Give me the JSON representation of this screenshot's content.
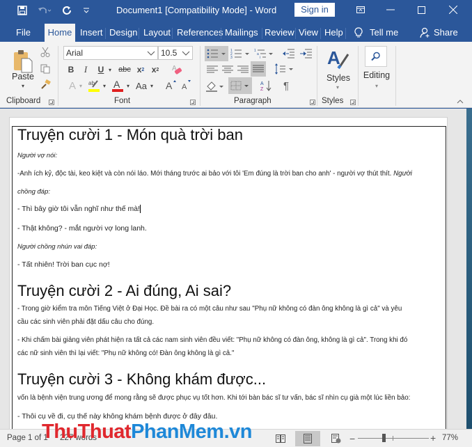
{
  "titlebar": {
    "title": "Document1 [Compatibility Mode]  -  Word",
    "sign_in": "Sign in",
    "qat": {
      "save_icon": "save-icon",
      "undo_icon": "undo-icon",
      "redo_icon": "redo-icon",
      "customize_icon": "customize-qat-icon"
    }
  },
  "tabs": [
    {
      "label": "File"
    },
    {
      "label": "Home",
      "active": true
    },
    {
      "label": "Insert"
    },
    {
      "label": "Design"
    },
    {
      "label": "Layout"
    },
    {
      "label": "References"
    },
    {
      "label": "Mailings"
    },
    {
      "label": "Review"
    },
    {
      "label": "View"
    },
    {
      "label": "Help"
    }
  ],
  "tell_me": "Tell me",
  "share": "Share",
  "ribbon": {
    "clipboard": {
      "label": "Clipboard",
      "paste": "Paste"
    },
    "font": {
      "label": "Font",
      "font_name": "Arial",
      "font_size": "10.5",
      "bold": "B",
      "italic": "I",
      "underline": "U",
      "strike": "abc",
      "subscript": "x",
      "superscript": "x",
      "change_case": "Aa",
      "highlight_color": "#ffff00",
      "font_color": "#e02020"
    },
    "paragraph": {
      "label": "Paragraph"
    },
    "styles": {
      "label": "Styles",
      "button": "Styles"
    },
    "editing": {
      "button": "Editing"
    }
  },
  "document": {
    "heading1": "Truyện cười 1 - Món quà trời ban",
    "p1": "Người vợ nói:",
    "p2a": "-Anh ích kỷ, độc tài, keo kiệt và còn nói láo. Mới tháng trước ai bảo với tôi 'Em đúng là trời ban cho anh' - người vợ thút thít.",
    "p2b": "Người",
    "p3": "chồng đáp:",
    "p4": "-   Thì bây giờ tôi vẫn nghĩ như thế mà!",
    "p5": "-   Thật không? - mắt người vợ long lanh.",
    "p6": "Người chồng nhún vai đáp:",
    "p7": "-   Tất nhiên! Trời ban cục nợ!",
    "heading2": "Truyện cười 2 - Ai đúng, Ai sai?",
    "p8": "-   Trong giờ kiểm tra môn Tiếng Việt ở Đại Học. Đề bài ra có một câu như sau \"Phụ nữ không có đàn ông không là gì cả\" và yêu",
    "p9": "cầu các sinh viên phải đặt dấu câu cho đúng.",
    "p10": "-   Khi chấm bài giảng viên phát hiện ra tất cả các nam sinh viên đều viết: \"Phụ nữ không có đàn ông, không là gì cả\". Trong khi đó",
    "p11": "các nữ sinh viên thì lại viết: \"Phụ nữ không có! Đàn ông không là gì cả.\"",
    "heading3": "Truyện cười 3 - Không khám được...",
    "p12": "vốn là bệnh viện trung ương để mong rằng sẽ được phục vụ tốt hơn. Khi tới bàn bác sĩ tư vấn, bác sĩ nhìn cụ già một lúc liền bảo:",
    "p13": "-   Thôi cụ về đi, cụ thế này không khám bệnh được ở đây đâu."
  },
  "statusbar": {
    "page": "Page 1 of 1",
    "words": "227 words",
    "zoom": "77%",
    "zoom_percent": 77
  },
  "watermark": {
    "part1": "ThuThuat",
    "part2": "PhanMem",
    "part3": ".vn"
  }
}
